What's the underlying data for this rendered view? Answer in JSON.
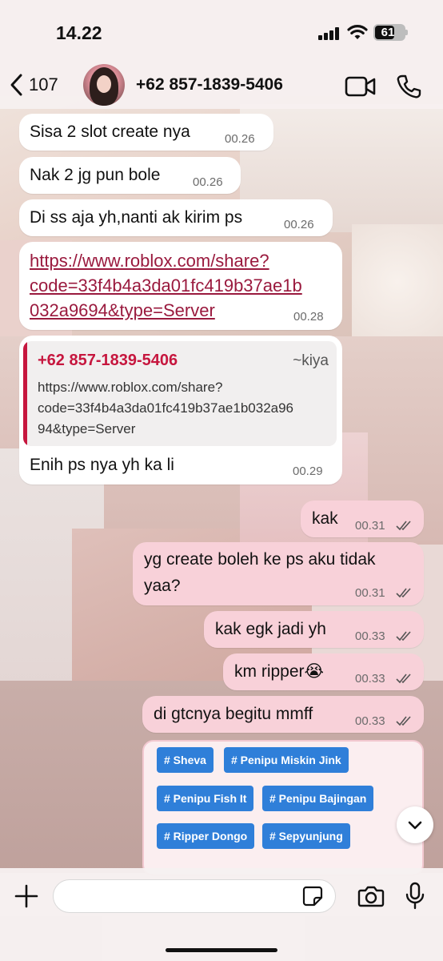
{
  "status": {
    "time": "14.22",
    "battery": "61"
  },
  "header": {
    "back_count": "107",
    "contact": "+62 857-1839-5406"
  },
  "messages": [
    {
      "text": "Sisa 2 slot create nya",
      "time": "00.26"
    },
    {
      "text": "Nak 2 jg pun bole",
      "time": "00.26"
    },
    {
      "text": "Di ss aja yh,nanti ak kirim ps",
      "time": "00.26"
    },
    {
      "link_lines": [
        "https://www.roblox.com/share?",
        "code=33f4b4a3da01fc419b37ae1b",
        "032a9694&type=Server"
      ],
      "time": "00.28"
    },
    {
      "quote": {
        "sender": "+62 857-1839-5406",
        "alias": "~kiya",
        "lines": [
          "https://www.roblox.com/share?",
          "code=33f4b4a3da01fc419b37ae1b032a96",
          "94&type=Server"
        ]
      },
      "text": "Enih ps nya yh ka li",
      "time": "00.29"
    },
    {
      "text": "kak",
      "time": "00.31"
    },
    {
      "lines": [
        "yg create boleh ke ps aku tidak",
        "yaa?"
      ],
      "time": "00.31"
    },
    {
      "text": "kak egk jadi yh",
      "time": "00.33"
    },
    {
      "text": "km ripper😭",
      "time": "00.33"
    },
    {
      "text": "di gtcnya begitu mmff",
      "time": "00.33"
    }
  ],
  "tags": [
    "# Sheva",
    "# Penipu Miskin Jink",
    "# Penipu Fish It",
    "# Penipu Bajingan",
    "# Ripper Dongo",
    "# Sepyunjung"
  ],
  "composer": {
    "placeholder": ""
  },
  "colors": {
    "outgoing_bubble": "#f8d1d9",
    "incoming_bubble": "#ffffff",
    "quote_accent": "#c6163e",
    "tag_blue": "#2f7fd9"
  },
  "icons": [
    "back-chevron-icon",
    "video-call-icon",
    "phone-call-icon",
    "plus-icon",
    "sticker-icon",
    "camera-icon",
    "microphone-icon",
    "chevron-down-icon",
    "read-ticks-icon"
  ]
}
